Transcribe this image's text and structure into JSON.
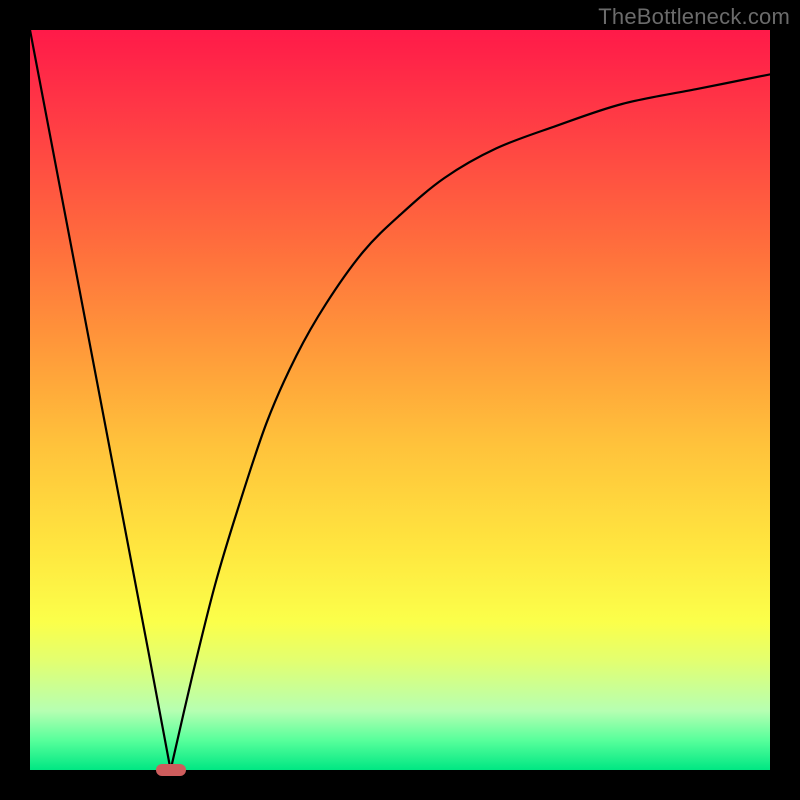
{
  "watermark": "TheBottleneck.com",
  "chart_data": {
    "type": "line",
    "title": "",
    "xlabel": "",
    "ylabel": "",
    "xlim": [
      0,
      100
    ],
    "ylim": [
      0,
      100
    ],
    "grid": false,
    "legend": false,
    "series": [
      {
        "name": "left-branch",
        "x": [
          0,
          4,
          8,
          12,
          16,
          19
        ],
        "y": [
          100,
          79,
          58,
          37,
          16,
          0
        ]
      },
      {
        "name": "right-branch",
        "x": [
          19,
          22,
          25,
          28,
          32,
          36,
          40,
          45,
          50,
          56,
          63,
          71,
          80,
          90,
          100
        ],
        "y": [
          0,
          13,
          25,
          35,
          47,
          56,
          63,
          70,
          75,
          80,
          84,
          87,
          90,
          92,
          94
        ]
      }
    ],
    "marker": {
      "x": 19,
      "y": 0,
      "shape": "pill",
      "color": "#cd5c5c"
    },
    "gradient_stops": [
      {
        "pos": 0.0,
        "color": "#ff1a49"
      },
      {
        "pos": 0.12,
        "color": "#ff3b45"
      },
      {
        "pos": 0.28,
        "color": "#ff6a3d"
      },
      {
        "pos": 0.42,
        "color": "#ff963a"
      },
      {
        "pos": 0.56,
        "color": "#ffc23b"
      },
      {
        "pos": 0.7,
        "color": "#ffe63f"
      },
      {
        "pos": 0.8,
        "color": "#fbff4a"
      },
      {
        "pos": 0.85,
        "color": "#e4ff6e"
      },
      {
        "pos": 0.92,
        "color": "#b6ffb2"
      },
      {
        "pos": 0.96,
        "color": "#57ff9b"
      },
      {
        "pos": 1.0,
        "color": "#00e783"
      }
    ]
  }
}
